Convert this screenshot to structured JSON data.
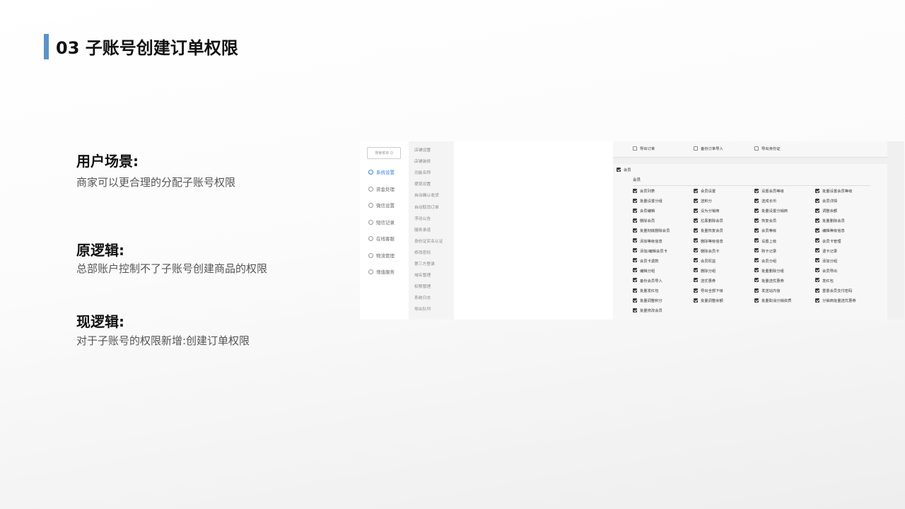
{
  "page": {
    "title": "03 子账号创建订单权限"
  },
  "sections": [
    {
      "heading": "用户场景:",
      "text": "商家可以更合理的分配子账号权限"
    },
    {
      "heading": "原逻辑:",
      "text": "总部账户控制不了子账号创建商品的权限"
    },
    {
      "heading": "现逻辑:",
      "text": "对于子账号的权限新增:创建订单权限"
    }
  ],
  "screenshot": {
    "search_placeholder": "搜索菜单 Q",
    "main_menu": [
      {
        "label": "系统设置",
        "icon": "gear-icon",
        "active": true
      },
      {
        "label": "资金处理",
        "icon": "coin-icon",
        "active": false
      },
      {
        "label": "微信设置",
        "icon": "wechat-icon",
        "active": false
      },
      {
        "label": "短信记录",
        "icon": "mail-icon",
        "active": false
      },
      {
        "label": "在线客服",
        "icon": "headset-icon",
        "active": false
      },
      {
        "label": "物流管理",
        "icon": "truck-icon",
        "active": false
      },
      {
        "label": "增值服务",
        "icon": "check-icon",
        "active": false
      }
    ],
    "sub_menu": [
      "店铺设置",
      "店铺装修",
      "功能名称",
      "提现设置",
      "自动确认收货",
      "自动取消订单",
      "浮动公告",
      "服务承诺",
      "身份证实名认证",
      "修改密码",
      "第三方登录",
      "域名管理",
      "权限管理",
      "系统日志",
      "导出队列"
    ],
    "top_options": [
      "导出订单",
      "备份订单导入",
      "导出身份证"
    ],
    "member_group": {
      "label": "会员",
      "sub_label": "会员"
    },
    "permissions": [
      "会员列表",
      "会员设置",
      "设置会员等级",
      "批量设置会员等级",
      "批量设置分组",
      "送积分",
      "送成长币",
      "会员详情",
      "会员编辑",
      "设为分销商",
      "批量设置分销商",
      "调整余额",
      "删除会员",
      "拉黑删除会员",
      "恢复会员",
      "批量删除会员",
      "批量彻底删除会员",
      "批量恢复会员",
      "会员等级",
      "编辑等级信息",
      "添加等级信息",
      "删除等级信息",
      "设置上级",
      "会员卡管理",
      "添加/编辑会员卡",
      "删除会员卡",
      "购卡记录",
      "退卡记录",
      "会员卡退款",
      "会员权益",
      "会员分组",
      "添加分组",
      "编辑分组",
      "删除分组",
      "批量删除分组",
      "会员导出",
      "备份会员导入",
      "送优惠券",
      "批量送优惠券",
      "发红包",
      "批量发红包",
      "导出全部下级",
      "发送站内信",
      "重置会员支付密码",
      "批量调整积分",
      "批量调整余额",
      "批量取消分销资质",
      "分销商批量送优惠券",
      "批量修改会员"
    ]
  }
}
